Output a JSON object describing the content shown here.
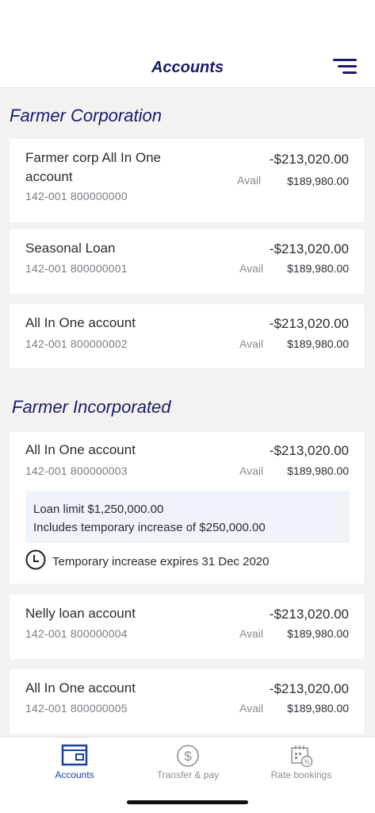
{
  "header": {
    "title": "Accounts"
  },
  "groups": [
    {
      "name": "Farmer Corporation"
    },
    {
      "name": "Farmer Incorporated"
    }
  ],
  "accounts": [
    {
      "name_line1": "Farmer corp All In One",
      "name_line2": "account",
      "number": "142-001 800000000",
      "balance": "-$213,020.00",
      "avail_label": "Avail",
      "avail": "$189,980.00"
    },
    {
      "name": "Seasonal Loan",
      "number": "142-001 800000001",
      "balance": "-$213,020.00",
      "avail_label": "Avail",
      "avail": "$189,980.00"
    },
    {
      "name": "All In One account",
      "number": "142-001 800000002",
      "balance": "-$213,020.00",
      "avail_label": "Avail",
      "avail": "$189,980.00"
    },
    {
      "name": "All In One account",
      "number": "142-001 800000003",
      "balance": "-$213,020.00",
      "avail_label": "Avail",
      "avail": "$189,980.00",
      "loan_limit": "Loan limit $1,250,000.00",
      "temp_increase": "Includes temporary increase of $250,000.00",
      "expiry": "Temporary increase expires 31 Dec 2020"
    },
    {
      "name": "Nelly loan account",
      "number": "142-001 800000004",
      "balance": "-$213,020.00",
      "avail_label": "Avail",
      "avail": "$189,980.00"
    },
    {
      "name": "All In One account",
      "number": "142-001 800000005",
      "balance": "-$213,020.00",
      "avail_label": "Avail",
      "avail": "$189,980.00"
    }
  ],
  "tabs": [
    {
      "label": "Accounts",
      "icon": "wallet-icon",
      "active": true
    },
    {
      "label": "Transfer & pay",
      "icon": "dollar-circle-icon",
      "active": false
    },
    {
      "label": "Rate bookings",
      "icon": "calendar-percent-icon",
      "active": false
    }
  ],
  "colors": {
    "brand": "#1a1c6b",
    "active_tab": "#1d3fa0",
    "inactive_tab": "#8e8e93",
    "loan_box": "#eef4fa"
  }
}
